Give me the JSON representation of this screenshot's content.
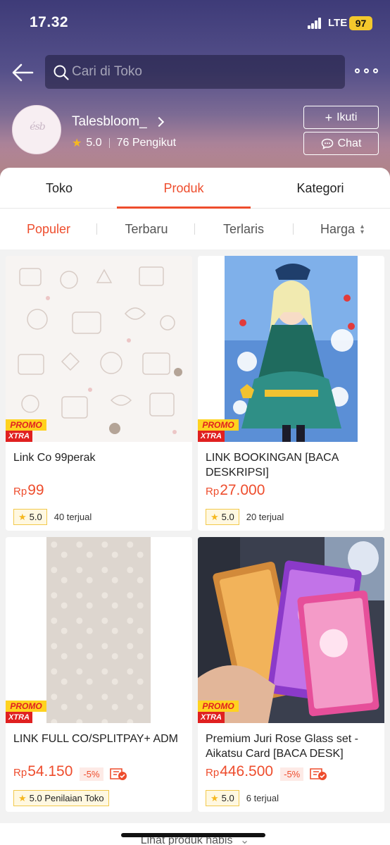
{
  "status_bar": {
    "time": "17.32",
    "network": "LTE",
    "battery": "97"
  },
  "search": {
    "placeholder": "Cari di Toko"
  },
  "shop": {
    "name": "Talesbloom_",
    "rating": "5.0",
    "followers": "76 Pengikut",
    "avatar_text": "ésb",
    "follow_label": "Ikuti",
    "chat_label": "Chat"
  },
  "tabs": [
    {
      "label": "Toko",
      "active": false
    },
    {
      "label": "Produk",
      "active": true
    },
    {
      "label": "Kategori",
      "active": false
    }
  ],
  "sorts": [
    {
      "label": "Populer",
      "active": true
    },
    {
      "label": "Terbaru",
      "active": false
    },
    {
      "label": "Terlaris",
      "active": false
    },
    {
      "label": "Harga",
      "active": false
    }
  ],
  "promo": {
    "line1": "PROMO",
    "line2": "XTRA"
  },
  "products": [
    {
      "title": "Link Co 99perak",
      "currency": "Rp",
      "price": "99",
      "discount": "",
      "rating": "5.0",
      "sold": "40 terjual"
    },
    {
      "title": "LINK BOOKINGAN [BACA DESKRIPSI]",
      "currency": "Rp",
      "price": "27.000",
      "discount": "",
      "rating": "5.0",
      "sold": "20 terjual"
    },
    {
      "title": "LINK FULL CO/SPLITPAY+ ADM",
      "currency": "Rp",
      "price": "54.150",
      "discount": "-5%",
      "rating": "5.0 Penilaian Toko",
      "sold": ""
    },
    {
      "title": "Premium Juri Rose Glass set - Aikatsu Card [BACA DESK]",
      "currency": "Rp",
      "price": "446.500",
      "discount": "-5%",
      "rating": "5.0",
      "sold": "6 terjual"
    }
  ],
  "footer": {
    "see_more": "Lihat produk habis"
  },
  "colors": {
    "accent": "#ee4d2d",
    "star": "#f5b820",
    "promo_yellow": "#ffd21f",
    "promo_red": "#e02020"
  }
}
